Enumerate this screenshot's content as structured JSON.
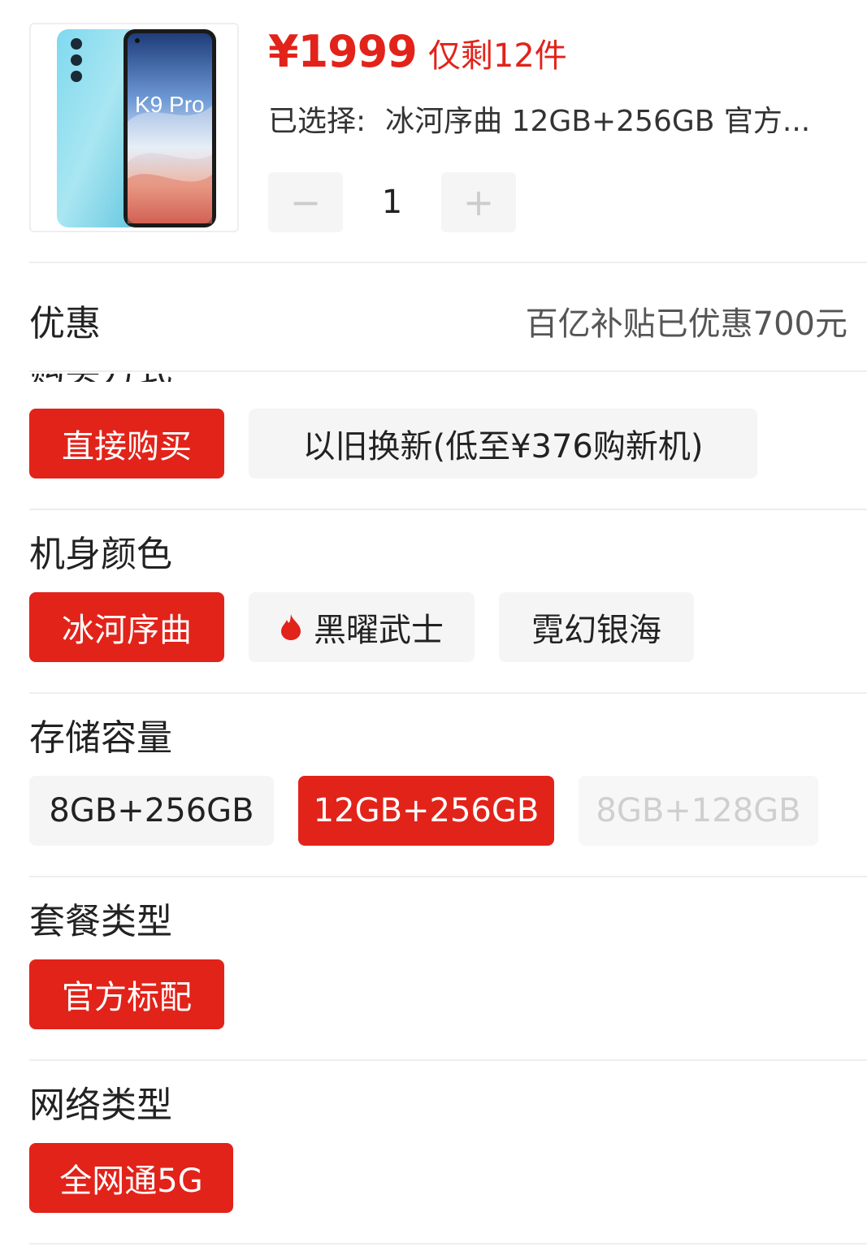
{
  "product": {
    "image_text": "K9 Pro",
    "price": "¥1999",
    "stock": "仅剩12件",
    "selected_label": "已选择:",
    "selected_value": "冰河序曲 12GB+256GB 官方..."
  },
  "quantity": {
    "minus": "−",
    "value": "1",
    "plus": "+"
  },
  "discount": {
    "title": "优惠",
    "value": "百亿补贴已优惠700元"
  },
  "purchase_method": {
    "title": "购买方式",
    "options": [
      {
        "label": "直接购买",
        "state": "selected"
      },
      {
        "label": "以旧换新(低至¥376购新机)",
        "state": "normal"
      }
    ]
  },
  "color": {
    "title": "机身颜色",
    "options": [
      {
        "label": "冰河序曲",
        "state": "selected"
      },
      {
        "label": "黑曜武士",
        "state": "normal",
        "icon": "flame-icon"
      },
      {
        "label": "霓幻银海",
        "state": "normal"
      }
    ]
  },
  "storage": {
    "title": "存储容量",
    "options": [
      {
        "label": "8GB+256GB",
        "state": "normal"
      },
      {
        "label": "12GB+256GB",
        "state": "selected"
      },
      {
        "label": "8GB+128GB",
        "state": "disabled"
      }
    ]
  },
  "package": {
    "title": "套餐类型",
    "options": [
      {
        "label": "官方标配",
        "state": "selected"
      }
    ]
  },
  "network": {
    "title": "网络类型",
    "options": [
      {
        "label": "全网通5G",
        "state": "selected"
      }
    ]
  },
  "colors": {
    "accent": "#e2231a",
    "option_bg": "#f5f5f5",
    "disabled_text": "#cfcfcf"
  }
}
